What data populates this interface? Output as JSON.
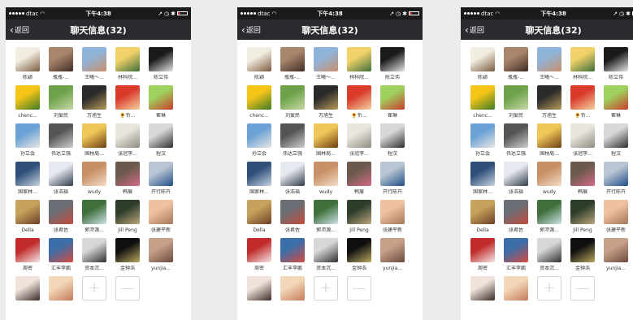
{
  "status_bar": {
    "carrier": "dtac",
    "time": "下午4:38",
    "battery_level": 0.15
  },
  "nav": {
    "back_label": "返回",
    "title": "聊天信息(32)"
  },
  "colors": {
    "statusbar": "#1a1a1a",
    "navbar": "#2b2b2f",
    "battery": "#e03b3b"
  },
  "members": [
    {
      "name": "陈颖",
      "c": [
        "#f2ede1",
        "#7a5a3c"
      ]
    },
    {
      "name": "瓶瓶-...",
      "c": [
        "#a9856c",
        "#3f2c25"
      ]
    },
    {
      "name": "王曦～...",
      "c": [
        "#8fb4d8",
        "#c98f6e"
      ]
    },
    {
      "name": "林科院...",
      "c": [
        "#f1d26a",
        "#3f6e3a"
      ]
    },
    {
      "name": "陈立伟",
      "c": [
        "#1a1a1a",
        "#e5e5e5"
      ]
    },
    {
      "name": "chenc...",
      "c": [
        "#f5c518",
        "#3d7a27"
      ]
    },
    {
      "name": "刘爱民",
      "c": [
        "#6ea24a",
        "#c7d9a6"
      ]
    },
    {
      "name": "万旭生",
      "c": [
        "#2a2a2a",
        "#b89b5a"
      ]
    },
    {
      "name": "🌻忻...",
      "c": [
        "#d93a2a",
        "#f4d3a2"
      ]
    },
    {
      "name": "崔琳",
      "c": [
        "#9fd15e",
        "#c93d2c"
      ]
    },
    {
      "name": "孙立会",
      "c": [
        "#6aa1d6",
        "#e9e7e1"
      ]
    },
    {
      "name": "伟达立强",
      "c": [
        "#555555",
        "#cfcfcf"
      ]
    },
    {
      "name": "国林局...",
      "c": [
        "#efc65a",
        "#6b3f10"
      ]
    },
    {
      "name": "张冠李...",
      "c": [
        "#e9e6de",
        "#8e8a7f"
      ]
    },
    {
      "name": "程汉",
      "c": [
        "#d8d8d8",
        "#2e2e2e"
      ]
    },
    {
      "name": "国家林...",
      "c": [
        "#2f4f7a",
        "#c6d3e1"
      ]
    },
    {
      "name": "张浩福",
      "c": [
        "#e6e9ef",
        "#2f3a4a"
      ]
    },
    {
      "name": "wudy",
      "c": [
        "#c89066",
        "#f4ddc8"
      ]
    },
    {
      "name": "韩展",
      "c": [
        "#6b5a4c",
        "#d46a86"
      ]
    },
    {
      "name": "开行陈卉",
      "c": [
        "#b9c6d3",
        "#1f4d87"
      ]
    },
    {
      "name": "Della",
      "c": [
        "#c7a25c",
        "#6d3f27"
      ]
    },
    {
      "name": "张君佐",
      "c": [
        "#6b6f76",
        "#c44a3b"
      ]
    },
    {
      "name": "郭沛源...",
      "c": [
        "#3f6f3a",
        "#cfe3e9"
      ]
    },
    {
      "name": "Jill Peng",
      "c": [
        "#2d3d2a",
        "#bca67e"
      ]
    },
    {
      "name": "张建平新",
      "c": [
        "#f0c1a1",
        "#a3775b"
      ]
    },
    {
      "name": "周密",
      "c": [
        "#c12b2b",
        "#f4e6e6"
      ]
    },
    {
      "name": "汇丰李鹏",
      "c": [
        "#3c6ea8",
        "#d64a41"
      ]
    },
    {
      "name": "资本沉...",
      "c": [
        "#d7d7d7",
        "#2f2f2f"
      ]
    },
    {
      "name": "金钟浩",
      "c": [
        "#0f0f0f",
        "#b9a95f"
      ]
    },
    {
      "name": "yunjia...",
      "c": [
        "#c7a08a",
        "#6b4a3c"
      ]
    },
    {
      "name": "",
      "c": [
        "#f1e3dc",
        "#3b2a26"
      ]
    },
    {
      "name": "",
      "c": [
        "#f3d7b9",
        "#c27b5a"
      ]
    }
  ],
  "add_symbol": "+",
  "remove_symbol": "—"
}
